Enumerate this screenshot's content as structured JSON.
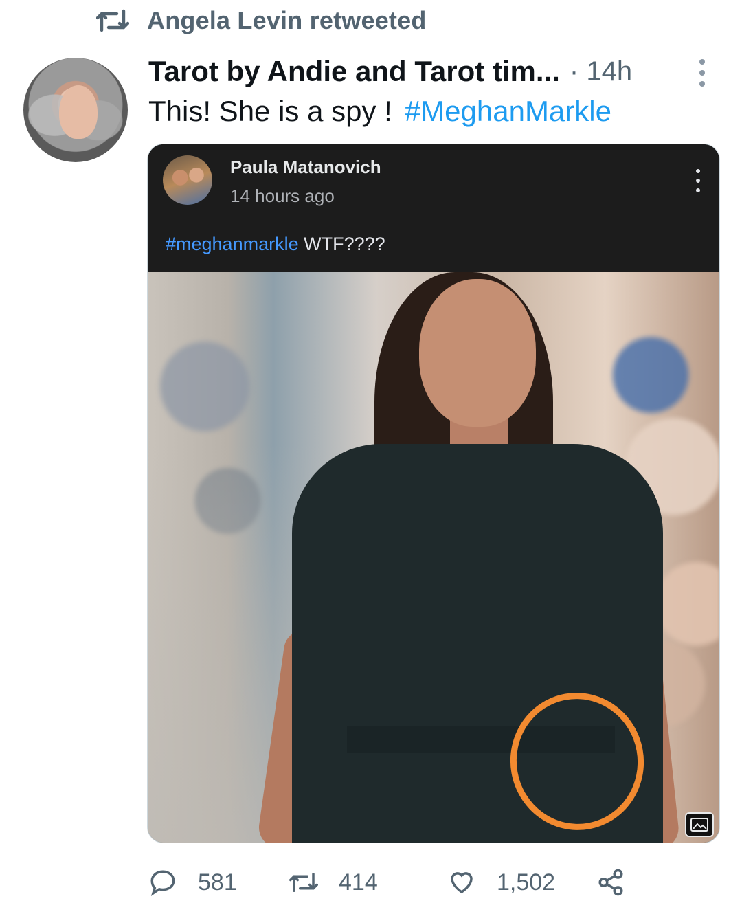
{
  "retweet_context": {
    "icon": "retweet-icon",
    "text": "Angela Levin retweeted"
  },
  "tweet": {
    "author_display": "Tarot by Andie and Tarot tim...",
    "time": "· 14h",
    "text": "This!  She is a spy !",
    "hashtag": "#MeghanMarkle",
    "more_icon": "more-vertical-icon"
  },
  "embedded_post": {
    "name": "Paula Matanovich",
    "time": "14 hours ago",
    "tag": "#meghanmarkle",
    "text": " WTF????",
    "more_icon": "more-vertical-icon",
    "image_badge_icon": "image-icon"
  },
  "actions": {
    "replies": "581",
    "retweets": "414",
    "likes": "1,502",
    "share_icon": "share-icon"
  },
  "colors": {
    "accent": "#1d9bf0",
    "muted": "#536471",
    "highlight_circle": "#f28a30",
    "embed_bg": "#1c1c1c"
  }
}
